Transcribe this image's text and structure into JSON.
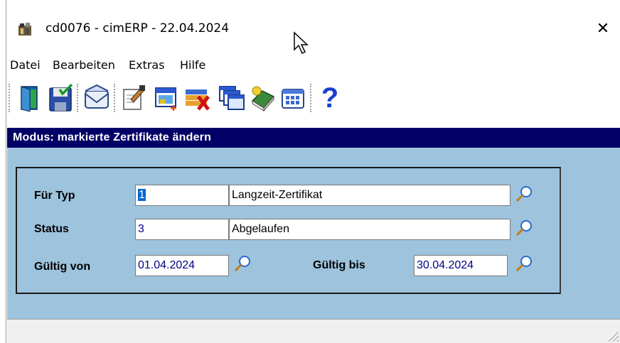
{
  "window": {
    "title": "cd0076 - cimERP - 22.04.2024",
    "close_glyph": "✕"
  },
  "menu": {
    "items": [
      {
        "label": "Datei"
      },
      {
        "label": "Bearbeiten"
      },
      {
        "label": "Extras"
      },
      {
        "label": "Hilfe"
      }
    ]
  },
  "toolbar": {
    "buttons": [
      {
        "icon": "exit-door-icon"
      },
      {
        "icon": "save-icon"
      },
      {
        "icon": "mail-icon"
      },
      {
        "icon": "edit-document-icon"
      },
      {
        "icon": "new-record-icon"
      },
      {
        "icon": "delete-record-icon"
      },
      {
        "icon": "windows-icon"
      },
      {
        "icon": "book-icon"
      },
      {
        "icon": "table-icon"
      },
      {
        "icon": "help-icon"
      }
    ],
    "help_glyph": "?"
  },
  "mode": {
    "text": "Modus: markierte Zertifikate ändern",
    "color": "#000066"
  },
  "form": {
    "typ_label": "Für Typ",
    "typ_code": "1",
    "typ_name": "Langzeit-Zertifikat",
    "status_label": "Status",
    "status_code": "3",
    "status_name": "Abgelaufen",
    "valid_from_label": "Gültig von",
    "valid_from": "01.04.2024",
    "valid_to_label": "Gültig bis",
    "valid_to": "30.04.2024"
  },
  "colors": {
    "panel_bg": "#9dc3dd",
    "title_bar": "#000066",
    "selection": "#0066cc"
  }
}
